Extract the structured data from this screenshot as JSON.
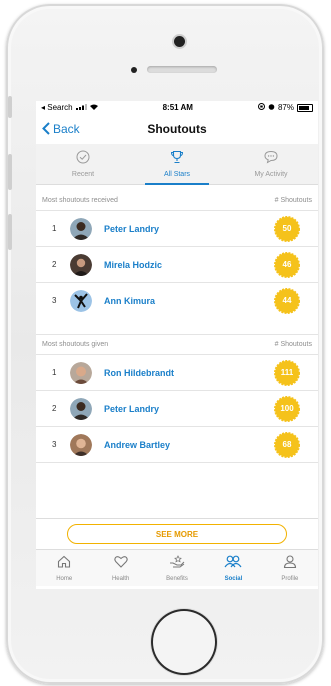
{
  "status": {
    "carrier": "◂ Search",
    "time": "8:51 AM",
    "battery": "87%"
  },
  "nav": {
    "back": "Back",
    "title": "Shoutouts"
  },
  "tabs": [
    {
      "label": "Recent",
      "icon": "check-circle-icon"
    },
    {
      "label": "All Stars",
      "icon": "trophy-icon",
      "active": true
    },
    {
      "label": "My Activity",
      "icon": "chat-bubble-icon"
    }
  ],
  "received": {
    "header": "Most shoutouts received",
    "count_header": "# Shoutouts",
    "rows": [
      {
        "rank": "1",
        "name": "Peter Landry",
        "count": "50"
      },
      {
        "rank": "2",
        "name": "Mirela Hodzic",
        "count": "46"
      },
      {
        "rank": "3",
        "name": "Ann Kimura",
        "count": "44"
      }
    ]
  },
  "given": {
    "header": "Most shoutouts given",
    "count_header": "# Shoutouts",
    "rows": [
      {
        "rank": "1",
        "name": "Ron Hildebrandt",
        "count": "111"
      },
      {
        "rank": "2",
        "name": "Peter Landry",
        "count": "100"
      },
      {
        "rank": "3",
        "name": "Andrew Bartley",
        "count": "68"
      }
    ]
  },
  "see_more": "SEE MORE",
  "tabbar": [
    {
      "label": "Home",
      "icon": "home-icon"
    },
    {
      "label": "Health",
      "icon": "heart-icon"
    },
    {
      "label": "Benefits",
      "icon": "benefits-hand-icon"
    },
    {
      "label": "Social",
      "icon": "people-icon",
      "active": true
    },
    {
      "label": "Profile",
      "icon": "person-icon"
    }
  ],
  "colors": {
    "accent": "#1a7fc9",
    "badge": "#f5c21b",
    "see_more": "#e59a00"
  }
}
